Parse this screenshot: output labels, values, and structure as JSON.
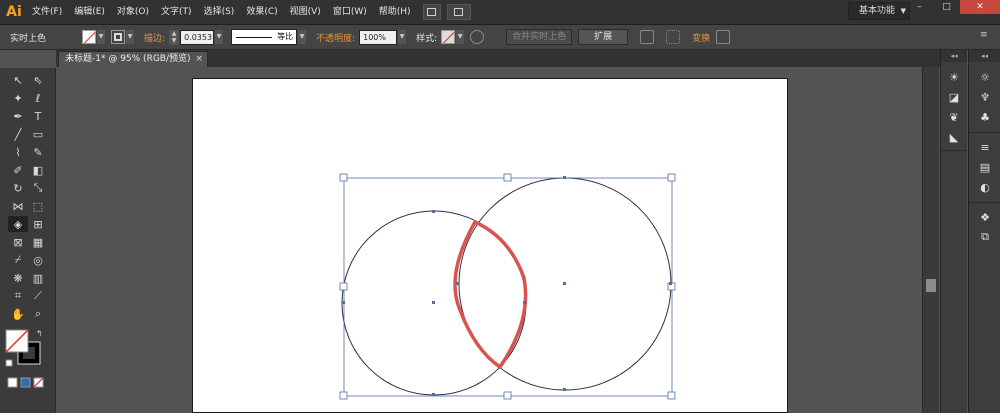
{
  "app": {
    "logo": "Ai",
    "menus": [
      "文件(F)",
      "编辑(E)",
      "对象(O)",
      "文字(T)",
      "选择(S)",
      "效果(C)",
      "视图(V)",
      "窗口(W)",
      "帮助(H)"
    ],
    "workspace": "基本功能",
    "window_controls": {
      "minimize": "–",
      "restore": "□",
      "close": "✕"
    }
  },
  "control_bar": {
    "mode_label": "实时上色",
    "stroke_label": "描边:",
    "stroke_width": "0.0353",
    "stroke_profile": "等比",
    "opacity_label": "不透明度:",
    "opacity_value": "100%",
    "style_label": "样式:",
    "merge_button": "合并实时上色",
    "expand_button": "扩展",
    "transform_label": "变换"
  },
  "document_tab": {
    "title": "未标题-1* @ 95% (RGB/预览)",
    "close": "×"
  },
  "artwork": {
    "stroke_color": "#2e2e40",
    "highlight_color": "#d9534f",
    "selection_color": "#4e6ea8",
    "shapes": [
      "circle-left",
      "circle-right",
      "lens-intersection"
    ]
  },
  "colors": {
    "menu_bg": "#323232",
    "panel_bg": "#3b3b3b",
    "canvas_bg": "#535353",
    "accent_orange": "#e7953a"
  }
}
